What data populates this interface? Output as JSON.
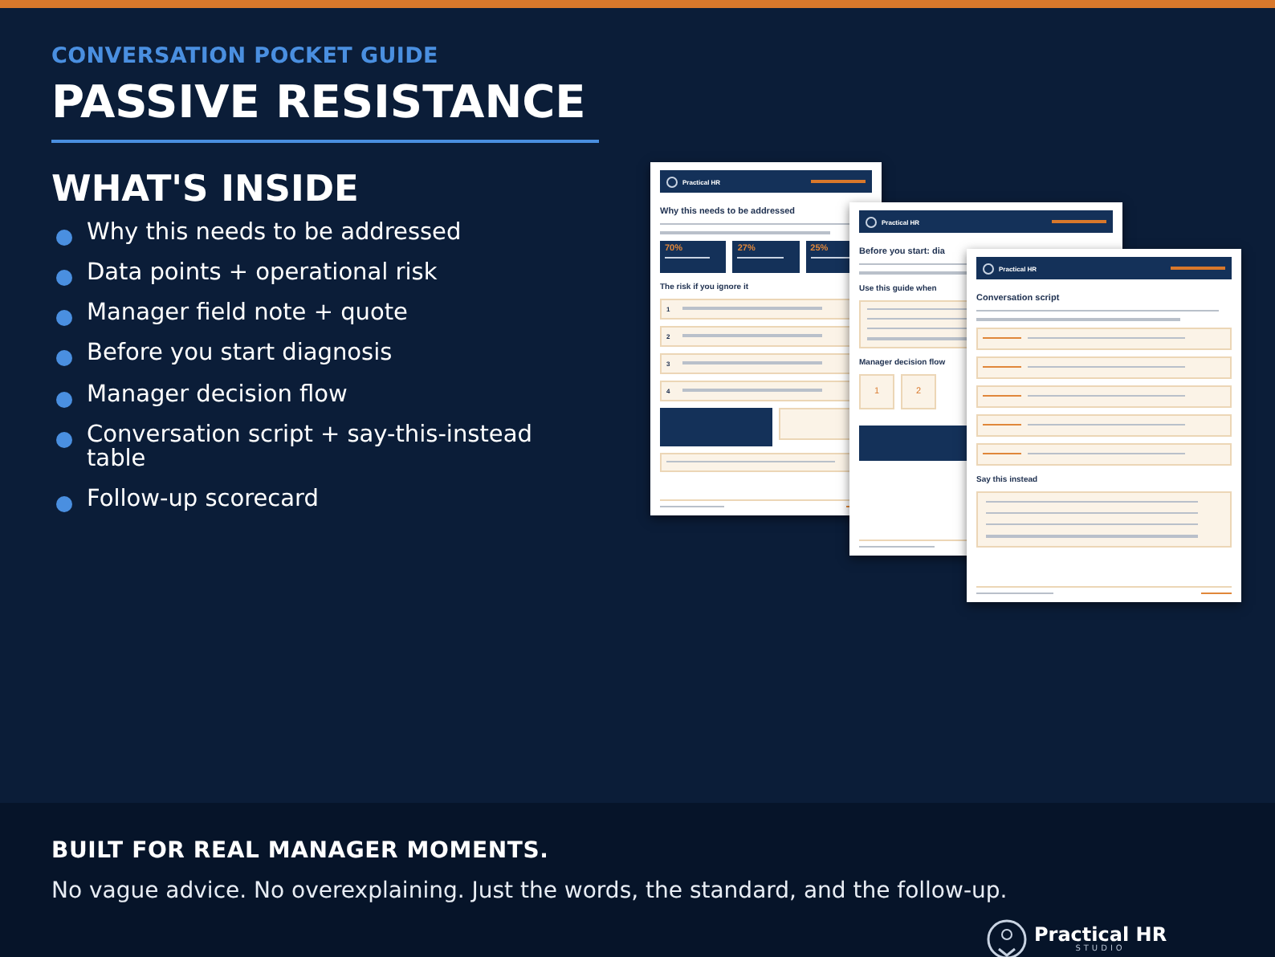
{
  "header": {
    "eyebrow": "CONVERSATION POCKET GUIDE",
    "title": "PASSIVE RESISTANCE"
  },
  "contents": {
    "heading": "WHAT'S INSIDE",
    "items": [
      "Why this needs to be addressed",
      "Data points + operational risk",
      "Manager field note + quote",
      "Before you start diagnosis",
      "Manager decision flow",
      "Conversation script + say-this-instead table",
      "Follow-up scorecard"
    ]
  },
  "pages": [
    {
      "brand": "Practical HR",
      "title": "Why this needs to be addressed",
      "blocks": [
        {
          "kind": "intro"
        },
        {
          "kind": "stats",
          "values": [
            "70%",
            "27%",
            "25%"
          ]
        },
        {
          "kind": "heading",
          "text": "The risk if you ignore it"
        },
        {
          "kind": "numbered",
          "numbers": [
            "1",
            "2",
            "3",
            "4"
          ]
        },
        {
          "kind": "callouts"
        },
        {
          "kind": "note"
        },
        {
          "kind": "footer"
        }
      ]
    },
    {
      "brand": "Practical HR",
      "title": "Before you start: dia",
      "blocks": [
        {
          "kind": "intro"
        },
        {
          "kind": "heading",
          "text": "Use this guide when"
        },
        {
          "kind": "checklist"
        },
        {
          "kind": "heading",
          "text": "Manager decision flow"
        },
        {
          "kind": "flow",
          "numbers": [
            "1",
            "2"
          ]
        },
        {
          "kind": "banner"
        },
        {
          "kind": "footer"
        }
      ]
    },
    {
      "brand": "Practical HR",
      "title": "Conversation script",
      "blocks": [
        {
          "kind": "intro"
        },
        {
          "kind": "script"
        },
        {
          "kind": "heading",
          "text": "Say this instead"
        },
        {
          "kind": "table"
        },
        {
          "kind": "footer"
        }
      ]
    }
  ],
  "footer": {
    "headline": "BUILT FOR REAL MANAGER MOMENTS.",
    "tagline": "No vague advice. No overexplaining. Just the words, the standard, and the follow-up.",
    "logo": {
      "name": "Practical HR",
      "sub": "STUDIO"
    }
  }
}
